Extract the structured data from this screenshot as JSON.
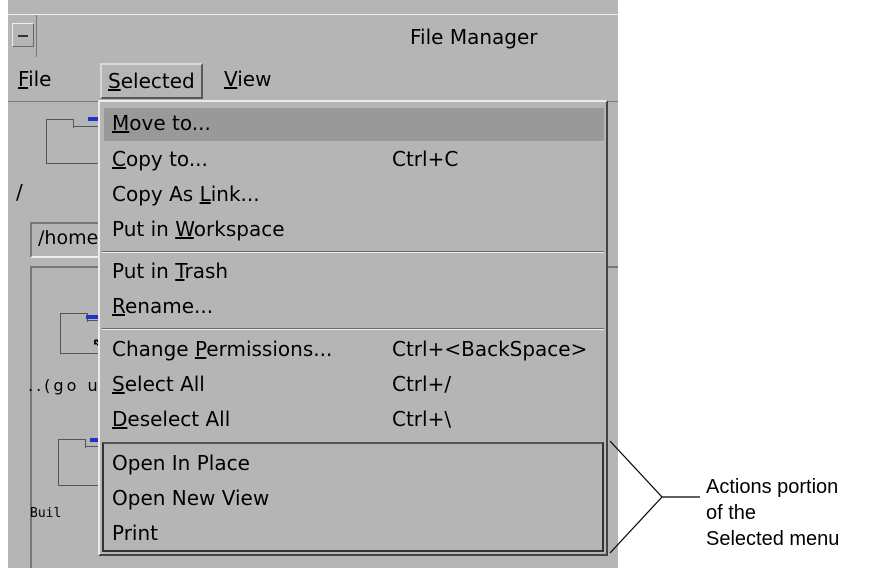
{
  "window": {
    "title": "File Manager",
    "menubar": [
      {
        "prefix": "",
        "mnemonic": "F",
        "rest": "ile"
      },
      {
        "prefix": "",
        "mnemonic": "S",
        "rest": "elected"
      },
      {
        "prefix": "",
        "mnemonic": "V",
        "rest": "iew"
      }
    ],
    "path_label": "/",
    "path_field": "/home",
    "items": [
      {
        "label": "..(go up)"
      },
      {
        "label": "Buil"
      }
    ]
  },
  "selected_menu": {
    "items": [
      {
        "pre": "",
        "mn": "M",
        "post": "ove to...",
        "accel": ""
      },
      {
        "pre": "",
        "mn": "C",
        "post": "opy to...",
        "accel": "Ctrl+C"
      },
      {
        "pre": "Copy As ",
        "mn": "L",
        "post": "ink...",
        "accel": ""
      },
      {
        "pre": "Put in ",
        "mn": "W",
        "post": "orkspace",
        "accel": ""
      },
      {
        "pre": "Put in ",
        "mn": "T",
        "post": "rash",
        "accel": ""
      },
      {
        "pre": "",
        "mn": "R",
        "post": "ename...",
        "accel": ""
      },
      {
        "pre": "Change ",
        "mn": "P",
        "post": "ermissions...",
        "accel": "Ctrl+<BackSpace>"
      },
      {
        "pre": "",
        "mn": "S",
        "post": "elect All",
        "accel": "Ctrl+/"
      },
      {
        "pre": "",
        "mn": "D",
        "post": "eselect All",
        "accel": "Ctrl+\\"
      },
      {
        "pre": "Open In Place",
        "mn": "",
        "post": "",
        "accel": ""
      },
      {
        "pre": "Open New View",
        "mn": "",
        "post": "",
        "accel": ""
      },
      {
        "pre": "Print",
        "mn": "",
        "post": "",
        "accel": ""
      }
    ]
  },
  "callout": {
    "line1": "Actions portion",
    "line2": "of the",
    "line3": "Selected menu"
  },
  "colors": {
    "chrome": "#b5b5b5",
    "highlight": "#999999",
    "folder_tip": "#1c34c8"
  }
}
